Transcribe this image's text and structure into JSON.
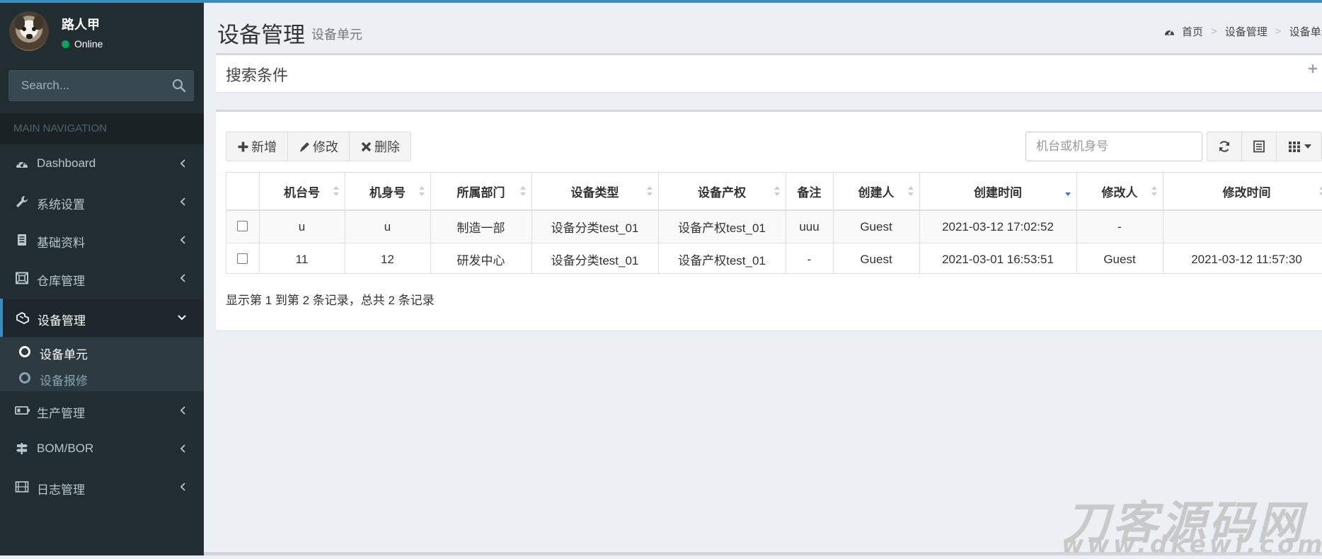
{
  "user": {
    "name": "路人甲",
    "status": "Online"
  },
  "sidebar": {
    "search_placeholder": "Search...",
    "nav_header": "MAIN NAVIGATION",
    "items": [
      {
        "label": "Dashboard",
        "icon": "dashboard-icon"
      },
      {
        "label": "系统设置",
        "icon": "wrench-icon"
      },
      {
        "label": "基础资料",
        "icon": "book-icon"
      },
      {
        "label": "仓库管理",
        "icon": "warehouse-icon"
      },
      {
        "label": "设备管理",
        "icon": "device-icon",
        "active": true,
        "children": [
          {
            "label": "设备单元",
            "active": true
          },
          {
            "label": "设备报修"
          }
        ]
      },
      {
        "label": "生产管理",
        "icon": "battery-icon"
      },
      {
        "label": "BOM/BOR",
        "icon": "signpost-icon"
      },
      {
        "label": "日志管理",
        "icon": "film-icon"
      }
    ]
  },
  "header": {
    "title": "设备管理",
    "subtitle": "设备单元",
    "breadcrumb": [
      "首页",
      "设备管理",
      "设备单元"
    ]
  },
  "search_box": {
    "title": "搜索条件"
  },
  "toolbar": {
    "add_label": "新增",
    "edit_label": "修改",
    "delete_label": "删除",
    "search_placeholder": "机台或机身号"
  },
  "table": {
    "columns": [
      "",
      "机台号",
      "机身号",
      "所属部门",
      "设备类型",
      "设备产权",
      "备注",
      "创建人",
      "创建时间",
      "修改人",
      "修改时间"
    ],
    "rows": [
      [
        "",
        "u",
        "u",
        "制造一部",
        "设备分类test_01",
        "设备产权test_01",
        "uuu",
        "Guest",
        "2021-03-12 17:02:52",
        "-",
        ""
      ],
      [
        "",
        "11",
        "12",
        "研发中心",
        "设备分类test_01",
        "设备产权test_01",
        "-",
        "Guest",
        "2021-03-01 16:53:51",
        "Guest",
        "2021-03-12 11:57:30"
      ]
    ]
  },
  "pagination": {
    "info": "显示第 1 到第 2 条记录，总共 2 条记录"
  },
  "watermark": {
    "line1": "刀客源码网",
    "line2": "www.dkewl.com"
  },
  "colors": {
    "sidebar": "#222d32",
    "accent": "#3c8dbc",
    "online": "#00a65a",
    "content_bg": "#ecf0f5"
  }
}
